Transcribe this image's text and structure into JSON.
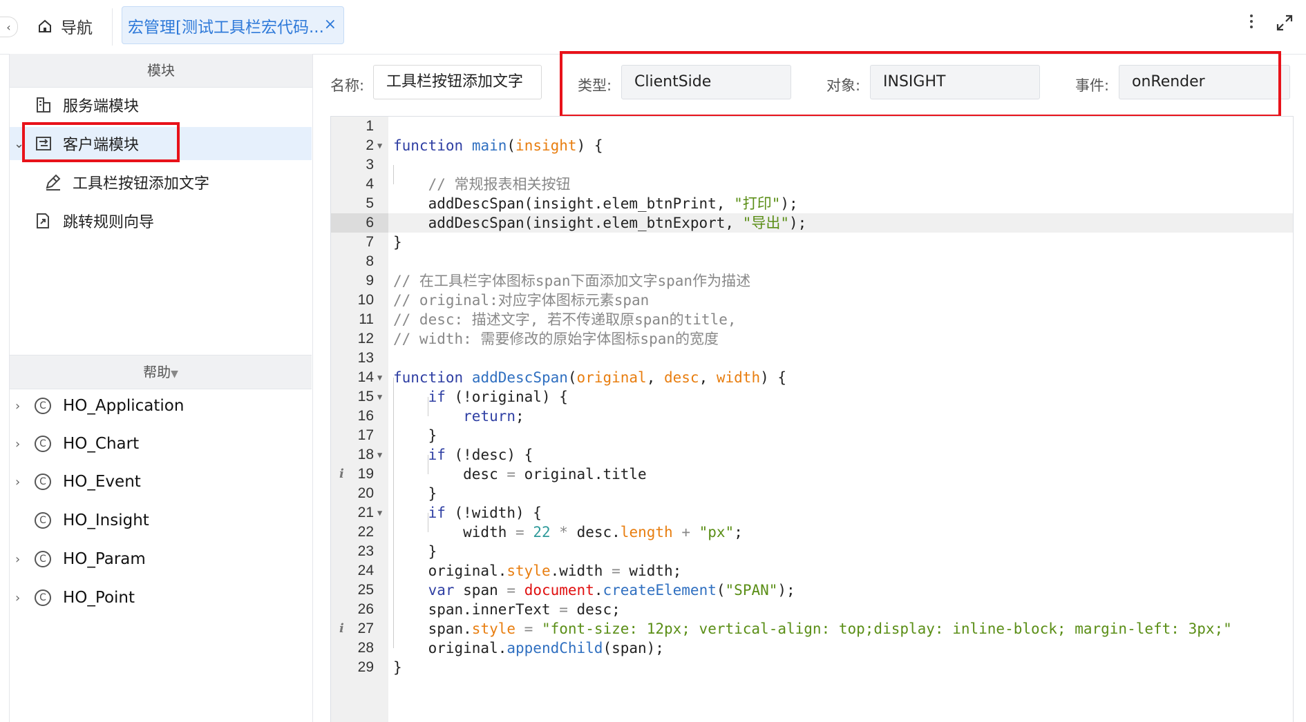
{
  "topbar": {
    "collapse_glyph": "‹",
    "nav_label": "导航",
    "active_tab_label": "宏管理[测试工具栏宏代码...",
    "close_glyph": "×"
  },
  "left": {
    "modules_header": "模块",
    "tree": [
      {
        "label": "服务端模块",
        "icon": "server-module-icon"
      },
      {
        "label": "客户端模块",
        "icon": "client-module-icon",
        "expanded": true,
        "selected": true
      },
      {
        "label": "工具栏按钮添加文字",
        "icon": "edit-script-icon"
      },
      {
        "label": "跳转规则向导",
        "icon": "jump-rule-icon"
      }
    ],
    "help_header": "帮助",
    "help_items": [
      {
        "label": "HO_Application",
        "expandable": true
      },
      {
        "label": "HO_Chart",
        "expandable": true
      },
      {
        "label": "HO_Event",
        "expandable": true
      },
      {
        "label": "HO_Insight",
        "expandable": false
      },
      {
        "label": "HO_Param",
        "expandable": true
      },
      {
        "label": "HO_Point",
        "expandable": true
      }
    ]
  },
  "form": {
    "name_label": "名称:",
    "name_value": "工具栏按钮添加文字",
    "type_label": "类型:",
    "type_value": "ClientSide",
    "object_label": "对象:",
    "object_value": "INSIGHT",
    "event_label": "事件:",
    "event_value": "onRender"
  },
  "editor": {
    "active_line": 6,
    "lines": [
      "1",
      "2",
      "3",
      "4",
      "5",
      "6",
      "7",
      "8",
      "9",
      "10",
      "11",
      "12",
      "13",
      "14",
      "15",
      "16",
      "17",
      "18",
      "19",
      "20",
      "21",
      "22",
      "23",
      "24",
      "25",
      "26",
      "27",
      "28",
      "29"
    ]
  },
  "colors": {
    "accent": "#2f7ad9",
    "highlight_box": "#e8121a",
    "keyword": "#2f3fa3",
    "string": "#5a8e16",
    "comment": "#888888",
    "param": "#e87e10"
  }
}
